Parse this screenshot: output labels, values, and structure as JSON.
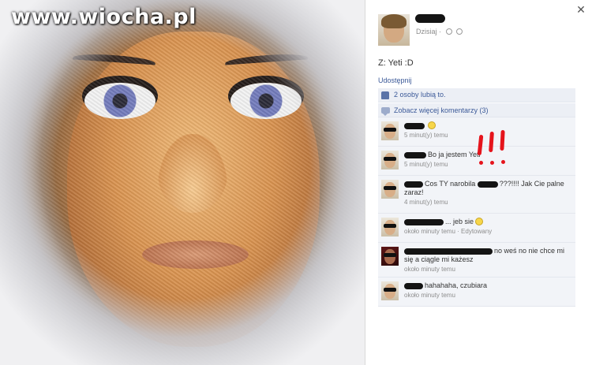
{
  "watermark": "www.wiocha.pl",
  "post": {
    "timestamp": "Dzisiaj",
    "text": "Z: Yeti :D",
    "share_label": "Udostępnij"
  },
  "feedback": {
    "likes_text": "2 osoby lubią to.",
    "more_comments": "Zobacz więcej komentarzy (3)"
  },
  "comments": [
    {
      "text": "",
      "has_smiley": true,
      "time": "5 minut(y) temu"
    },
    {
      "text": "Bo ja jestem Yeti",
      "time": "5 minut(y) temu"
    },
    {
      "text_before": "Cos TY narobila",
      "text_after": "???!!!! Jak Cie palne zaraz!",
      "time": "4 minut(y) temu"
    },
    {
      "text": "... jeb sie",
      "has_smiley": true,
      "time": "około minuty temu · Edytowany"
    },
    {
      "text": "no weś no nie chce mi się a ciągle mi każesz",
      "time": "około minuty temu"
    },
    {
      "text": "hahahaha, czubiara",
      "time": "około minuty temu"
    }
  ],
  "annotation": "!!!",
  "colors": {
    "link_blue": "#3b5998",
    "comment_bg": "#f2f4f8",
    "feedback_bg": "#eceff5",
    "annotation_red": "#e5141c",
    "redaction": "#141414"
  },
  "icons": [
    "close-icon",
    "clock-icon",
    "globe-icon",
    "thumbs-up-icon",
    "comment-bubble-icon",
    "smiley-icon"
  ]
}
